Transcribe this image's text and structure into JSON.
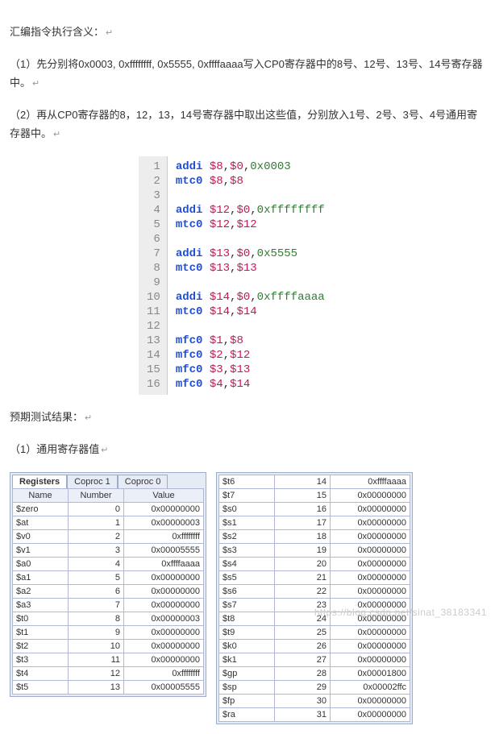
{
  "text": {
    "title": "汇编指令执行含义：",
    "p1": "（1）先分别将0x0003, 0xffffffff, 0x5555, 0xffffaaaa写入CP0寄存器中的8号、12号、13号、14号寄存器中。",
    "p2": "（2）再从CP0寄存器的8，12，13，14号寄存器中取出这些值，分别放入1号、2号、3号、4号通用寄存器中。",
    "expected": "预期测试结果：",
    "sub1": "（1）通用寄存器值"
  },
  "ret_symbol": "↵",
  "code": {
    "lines": [
      {
        "n": 1,
        "parts": [
          {
            "t": "addi ",
            "c": "kw"
          },
          {
            "t": "$8",
            "c": "reg"
          },
          {
            "t": ","
          },
          {
            "t": "$0",
            "c": "reg"
          },
          {
            "t": ","
          },
          {
            "t": "0x0003",
            "c": "num"
          }
        ]
      },
      {
        "n": 2,
        "parts": [
          {
            "t": "mtc0 ",
            "c": "kw"
          },
          {
            "t": "$8",
            "c": "reg"
          },
          {
            "t": ","
          },
          {
            "t": "$8",
            "c": "reg"
          }
        ]
      },
      {
        "n": 3,
        "parts": []
      },
      {
        "n": 4,
        "parts": [
          {
            "t": "addi ",
            "c": "kw"
          },
          {
            "t": "$12",
            "c": "reg"
          },
          {
            "t": ","
          },
          {
            "t": "$0",
            "c": "reg"
          },
          {
            "t": ","
          },
          {
            "t": "0xffffffff",
            "c": "num"
          }
        ]
      },
      {
        "n": 5,
        "parts": [
          {
            "t": "mtc0 ",
            "c": "kw"
          },
          {
            "t": "$12",
            "c": "reg"
          },
          {
            "t": ","
          },
          {
            "t": "$12",
            "c": "reg"
          }
        ]
      },
      {
        "n": 6,
        "parts": []
      },
      {
        "n": 7,
        "parts": [
          {
            "t": "addi ",
            "c": "kw"
          },
          {
            "t": "$13",
            "c": "reg"
          },
          {
            "t": ","
          },
          {
            "t": "$0",
            "c": "reg"
          },
          {
            "t": ","
          },
          {
            "t": "0x5555",
            "c": "num"
          }
        ]
      },
      {
        "n": 8,
        "parts": [
          {
            "t": "mtc0 ",
            "c": "kw"
          },
          {
            "t": "$13",
            "c": "reg"
          },
          {
            "t": ","
          },
          {
            "t": "$13",
            "c": "reg"
          }
        ]
      },
      {
        "n": 9,
        "parts": []
      },
      {
        "n": 10,
        "parts": [
          {
            "t": "addi ",
            "c": "kw"
          },
          {
            "t": "$14",
            "c": "reg"
          },
          {
            "t": ","
          },
          {
            "t": "$0",
            "c": "reg"
          },
          {
            "t": ","
          },
          {
            "t": "0xffffaaaa",
            "c": "num"
          }
        ]
      },
      {
        "n": 11,
        "parts": [
          {
            "t": "mtc0 ",
            "c": "kw"
          },
          {
            "t": "$14",
            "c": "reg"
          },
          {
            "t": ","
          },
          {
            "t": "$14",
            "c": "reg"
          }
        ]
      },
      {
        "n": 12,
        "parts": []
      },
      {
        "n": 13,
        "parts": [
          {
            "t": "mfc0 ",
            "c": "kw"
          },
          {
            "t": "$1",
            "c": "reg"
          },
          {
            "t": ","
          },
          {
            "t": "$8",
            "c": "reg"
          }
        ]
      },
      {
        "n": 14,
        "parts": [
          {
            "t": "mfc0 ",
            "c": "kw"
          },
          {
            "t": "$2",
            "c": "reg"
          },
          {
            "t": ","
          },
          {
            "t": "$12",
            "c": "reg"
          }
        ]
      },
      {
        "n": 15,
        "parts": [
          {
            "t": "mfc0 ",
            "c": "kw"
          },
          {
            "t": "$3",
            "c": "reg"
          },
          {
            "t": ","
          },
          {
            "t": "$13",
            "c": "reg"
          }
        ]
      },
      {
        "n": 16,
        "parts": [
          {
            "t": "mfc0 ",
            "c": "kw"
          },
          {
            "t": "$4",
            "c": "reg"
          },
          {
            "t": ","
          },
          {
            "t": "$14",
            "c": "reg"
          }
        ]
      }
    ]
  },
  "tabs": {
    "active": "Registers",
    "others": [
      "Coproc 1",
      "Coproc 0"
    ]
  },
  "headers": {
    "name": "Name",
    "number": "Number",
    "value": "Value"
  },
  "left_regs": [
    {
      "name": "$zero",
      "num": 0,
      "val": "0x00000000"
    },
    {
      "name": "$at",
      "num": 1,
      "val": "0x00000003"
    },
    {
      "name": "$v0",
      "num": 2,
      "val": "0xffffffff"
    },
    {
      "name": "$v1",
      "num": 3,
      "val": "0x00005555"
    },
    {
      "name": "$a0",
      "num": 4,
      "val": "0xffffaaaa"
    },
    {
      "name": "$a1",
      "num": 5,
      "val": "0x00000000"
    },
    {
      "name": "$a2",
      "num": 6,
      "val": "0x00000000"
    },
    {
      "name": "$a3",
      "num": 7,
      "val": "0x00000000"
    },
    {
      "name": "$t0",
      "num": 8,
      "val": "0x00000003"
    },
    {
      "name": "$t1",
      "num": 9,
      "val": "0x00000000"
    },
    {
      "name": "$t2",
      "num": 10,
      "val": "0x00000000"
    },
    {
      "name": "$t3",
      "num": 11,
      "val": "0x00000000"
    },
    {
      "name": "$t4",
      "num": 12,
      "val": "0xffffffff"
    },
    {
      "name": "$t5",
      "num": 13,
      "val": "0x00005555"
    }
  ],
  "right_regs": [
    {
      "name": "$t6",
      "num": 14,
      "val": "0xffffaaaa"
    },
    {
      "name": "$t7",
      "num": 15,
      "val": "0x00000000"
    },
    {
      "name": "$s0",
      "num": 16,
      "val": "0x00000000"
    },
    {
      "name": "$s1",
      "num": 17,
      "val": "0x00000000"
    },
    {
      "name": "$s2",
      "num": 18,
      "val": "0x00000000"
    },
    {
      "name": "$s3",
      "num": 19,
      "val": "0x00000000"
    },
    {
      "name": "$s4",
      "num": 20,
      "val": "0x00000000"
    },
    {
      "name": "$s5",
      "num": 21,
      "val": "0x00000000"
    },
    {
      "name": "$s6",
      "num": 22,
      "val": "0x00000000"
    },
    {
      "name": "$s7",
      "num": 23,
      "val": "0x00000000"
    },
    {
      "name": "$t8",
      "num": 24,
      "val": "0x00000000"
    },
    {
      "name": "$t9",
      "num": 25,
      "val": "0x00000000"
    },
    {
      "name": "$k0",
      "num": 26,
      "val": "0x00000000"
    },
    {
      "name": "$k1",
      "num": 27,
      "val": "0x00000000"
    },
    {
      "name": "$gp",
      "num": 28,
      "val": "0x00001800"
    },
    {
      "name": "$sp",
      "num": 29,
      "val": "0x00002ffc"
    },
    {
      "name": "$fp",
      "num": 30,
      "val": "0x00000000"
    },
    {
      "name": "$ra",
      "num": 31,
      "val": "0x00000000"
    }
  ],
  "watermark": "https://blog.csdn.net/sinat_38183341"
}
